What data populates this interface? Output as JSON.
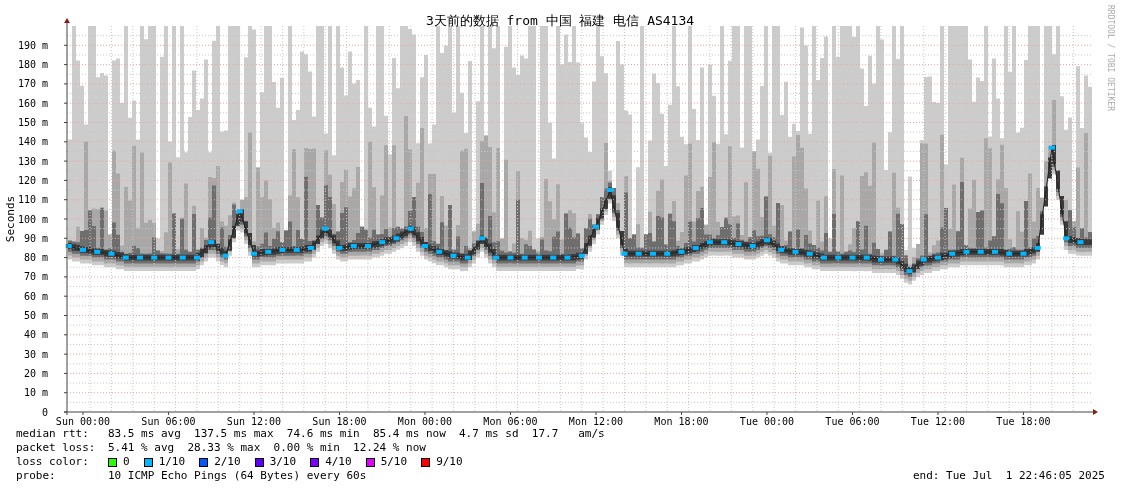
{
  "graph": {
    "side_credit": "RRDTOOL / TOBI OETIKER",
    "chart_data": {
      "type": "line",
      "title": "3天前的数据 from 中国 福建 电信 AS4134",
      "ylabel": "Seconds",
      "categories": [
        null,
        "Sun 00:00",
        null,
        null,
        null,
        null,
        null,
        "Sun 06:00",
        null,
        null,
        null,
        null,
        null,
        "Sun 12:00",
        null,
        null,
        null,
        null,
        null,
        "Sun 18:00",
        null,
        null,
        null,
        null,
        null,
        "Mon 00:00",
        null,
        null,
        null,
        null,
        null,
        "Mon 06:00",
        null,
        null,
        null,
        null,
        null,
        "Mon 12:00",
        null,
        null,
        null,
        null,
        null,
        "Mon 18:00",
        null,
        null,
        null,
        null,
        null,
        "Tue 00:00",
        null,
        null,
        null,
        null,
        null,
        "Tue 06:00",
        null,
        null,
        null,
        null,
        null,
        "Tue 12:00",
        null,
        null,
        null,
        null,
        null,
        "Tue 18:00",
        null,
        null,
        null,
        null
      ],
      "grid": true,
      "series": [
        {
          "color": "#00b8ff",
          "marker": "square",
          "values": [
            86,
            84,
            83,
            82,
            80,
            80,
            80,
            80,
            80,
            80,
            88,
            81,
            104,
            82,
            83,
            84,
            84,
            85,
            95,
            85,
            86,
            86,
            88,
            90,
            95,
            86,
            83,
            81,
            80,
            90,
            80,
            80,
            80,
            80,
            80,
            80,
            81,
            96,
            115,
            82,
            82,
            82,
            82,
            83,
            85,
            88,
            88,
            87,
            86,
            89,
            84,
            83,
            82,
            80,
            80,
            80,
            80,
            79,
            79,
            73,
            79,
            80,
            82,
            83,
            83,
            83,
            82,
            82,
            85,
            137,
            90,
            88
          ]
        }
      ],
      "ylim": [
        0,
        200
      ],
      "yticks": [
        {
          "value": 0,
          "label": "0"
        },
        {
          "value": 10,
          "label": "10 m"
        },
        {
          "value": 20,
          "label": "20 m"
        },
        {
          "value": 30,
          "label": "30 m"
        },
        {
          "value": 40,
          "label": "40 m"
        },
        {
          "value": 50,
          "label": "50 m"
        },
        {
          "value": 60,
          "label": "60 m"
        },
        {
          "value": 70,
          "label": "70 m"
        },
        {
          "value": 80,
          "label": "80 m"
        },
        {
          "value": 90,
          "label": "90 m"
        },
        {
          "value": 100,
          "label": "100 m"
        },
        {
          "value": 110,
          "label": "110 m"
        },
        {
          "value": 120,
          "label": "120 m"
        },
        {
          "value": 130,
          "label": "130 m"
        },
        {
          "value": 140,
          "label": "140 m"
        },
        {
          "value": 150,
          "label": "150 m"
        },
        {
          "value": 160,
          "label": "160 m"
        },
        {
          "value": 170,
          "label": "170 m"
        },
        {
          "value": 180,
          "label": "180 m"
        },
        {
          "value": 190,
          "label": "190 m"
        }
      ]
    }
  },
  "legend": {
    "rows": [
      {
        "label": "median rtt:",
        "text": "83.5 ms avg  137.5 ms max  74.6 ms min  85.4 ms now  4.7 ms sd  17.7   am/s"
      },
      {
        "label": "packet loss:",
        "text": "5.41 % avg  28.33 % max  0.00 % min  12.24 % now"
      }
    ],
    "loss_color": {
      "label": "loss color:",
      "items": [
        {
          "label": "0",
          "color": "#26ff00"
        },
        {
          "label": "1/10",
          "color": "#00b8ff"
        },
        {
          "label": "2/10",
          "color": "#0059ff"
        },
        {
          "label": "3/10",
          "color": "#5e00ff"
        },
        {
          "label": "4/10",
          "color": "#7e00ff"
        },
        {
          "label": "5/10",
          "color": "#dd00ff"
        },
        {
          "label": "9/10",
          "color": "#ff0000"
        }
      ]
    },
    "probe": {
      "label": "probe:",
      "text": "10 ICMP Echo Pings (64 Bytes) every 60s"
    },
    "end": "end: Tue Jul  1 22:46:05 2025"
  }
}
